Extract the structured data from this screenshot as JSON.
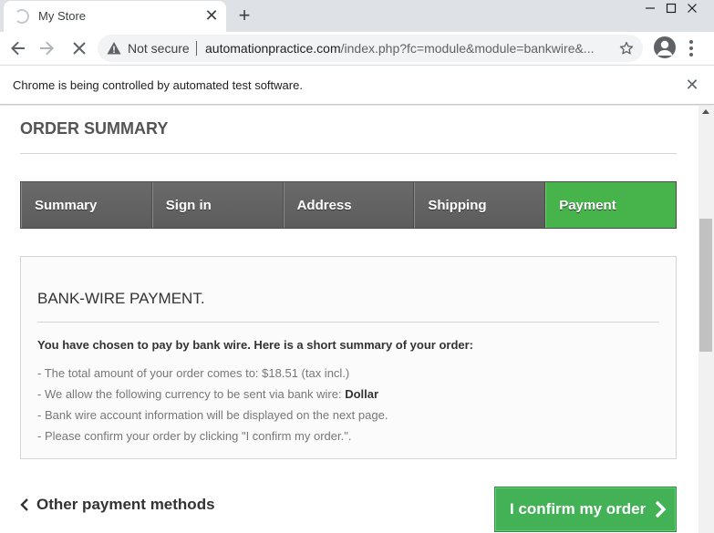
{
  "browser": {
    "tab_title": "My Store",
    "tab_close": "✕",
    "new_tab": "+",
    "not_secure": "Not secure",
    "url_host": "automationpractice.com",
    "url_path": "/index.php?fc=module&module=bankwire&...",
    "infobar_text": "Chrome is being controlled by automated test software.",
    "infobar_close": "✕"
  },
  "page": {
    "heading": "ORDER SUMMARY",
    "steps": [
      {
        "label": "Summary",
        "active": false
      },
      {
        "label": "Sign in",
        "active": false
      },
      {
        "label": "Address",
        "active": false
      },
      {
        "label": "Shipping",
        "active": false
      },
      {
        "label": "Payment",
        "active": true
      }
    ],
    "box": {
      "title": "BANK-WIRE PAYMENT.",
      "lead": "You have chosen to pay by bank wire. Here is a short summary of your order:",
      "line1": "- The total amount of your order comes to: $18.51 (tax incl.)",
      "line2_prefix": "- We allow the following currency to be sent via bank wire: ",
      "line2_currency": "Dollar",
      "line3": "- Bank wire account information will be displayed on the next page.",
      "line4": "- Please confirm your order by clicking \"I confirm my order.\"."
    },
    "back_link": "Other payment methods",
    "confirm_button": "I confirm my order"
  },
  "colors": {
    "active_step": "#47b44b",
    "inactive_step": "#616161",
    "confirm_button": "#43b155"
  },
  "icons": {
    "tab": "loading-spinner-icon",
    "back": "back-arrow-icon",
    "forward": "forward-arrow-icon",
    "stop": "stop-loading-icon",
    "warning": "warning-triangle-icon",
    "star": "bookmark-star-icon",
    "profile": "profile-avatar-icon",
    "menu": "more-vert-icon"
  }
}
